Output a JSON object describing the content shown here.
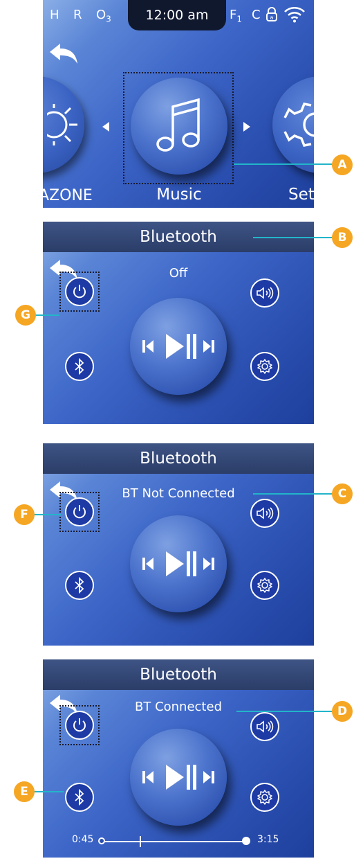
{
  "status_bar": {
    "h": "H",
    "r": "R",
    "o": "O",
    "o_sub": "3",
    "time": "12:00 am",
    "f": "F",
    "f_sub": "1",
    "c": "C"
  },
  "carousel": {
    "left_label": "AZONE",
    "center_label": "Music",
    "right_label": "Set"
  },
  "screens": [
    {
      "title": "Bluetooth",
      "status": "Off"
    },
    {
      "title": "Bluetooth",
      "status": "BT Not Connected"
    },
    {
      "title": "Bluetooth",
      "status": "BT Connected",
      "time_elapsed": "0:45",
      "time_total": "3:15",
      "progress": 0.0
    }
  ],
  "callouts": {
    "a": "A",
    "b": "B",
    "c": "C",
    "d": "D",
    "e": "E",
    "f": "F",
    "g": "G"
  },
  "colors": {
    "accent": "#22b5c9",
    "badge": "#f5a623",
    "button": "#1d3aa5",
    "titlebar": "#2b3d68"
  }
}
